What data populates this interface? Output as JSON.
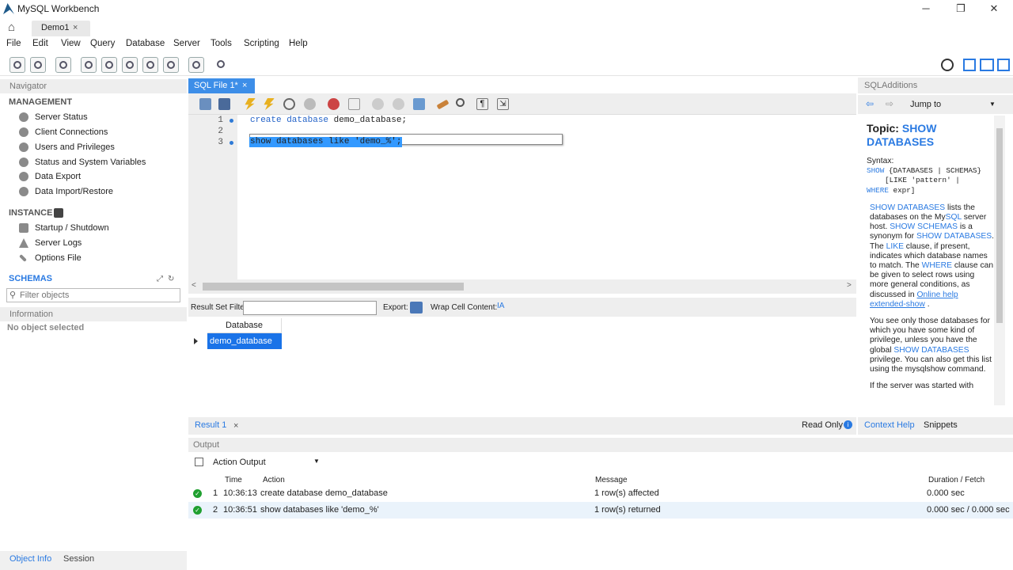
{
  "window": {
    "title": "MySQL Workbench",
    "minimize_icon": "minimize-icon",
    "restore_icon": "restore-icon",
    "close_icon": "close-icon"
  },
  "tabs": {
    "connection_tab": "Demo1",
    "close": "×"
  },
  "menu": [
    "File",
    "Edit",
    "View",
    "Query",
    "Database",
    "Server",
    "Tools",
    "Scripting",
    "Help"
  ],
  "navigator": {
    "header": "Navigator",
    "management_title": "MANAGEMENT",
    "management_items": [
      "Server Status",
      "Client Connections",
      "Users and Privileges",
      "Status and System Variables",
      "Data Export",
      "Data Import/Restore"
    ],
    "instance_title": "INSTANCE",
    "instance_items": [
      "Startup / Shutdown",
      "Server Logs",
      "Options File"
    ],
    "schemas_title": "SCHEMAS",
    "filter_placeholder": "Filter objects",
    "information_header": "Information",
    "no_object": "No object selected",
    "bottom_tabs": [
      "Object Info",
      "Session"
    ]
  },
  "editor": {
    "tab_label": "SQL File 1*",
    "tab_close": "×",
    "lines": [
      "1",
      "2",
      "3"
    ],
    "line1_kw": "create database",
    "line1_rest": " demo_database;",
    "line3": "show databases like 'demo_%';"
  },
  "results": {
    "filter_label": "Result Set Filter:",
    "export_label": "Export:",
    "wrap_label": "Wrap Cell Content:",
    "column": "Database",
    "rows": [
      "demo_database"
    ],
    "result_tab": "Result 1",
    "result_close": "×",
    "read_only": "Read Only"
  },
  "output": {
    "header": "Output",
    "selector": "Action Output",
    "columns": {
      "time": "Time",
      "action": "Action",
      "message": "Message",
      "duration": "Duration / Fetch"
    },
    "rows": [
      {
        "n": "1",
        "time": "10:36:13",
        "action": "create database demo_database",
        "message": "1 row(s) affected",
        "duration": "0.000 sec"
      },
      {
        "n": "2",
        "time": "10:36:51",
        "action": "show databases like 'demo_%'",
        "message": "1 row(s) returned",
        "duration": "0.000 sec / 0.000 sec"
      }
    ]
  },
  "sql_additions": {
    "header": "SQLAdditions",
    "jump_to": "Jump to",
    "topic_label": "Topic:",
    "topic_name": "SHOW DATABASES",
    "syntax_label": "Syntax:",
    "syntax_l1a": "SHOW",
    "syntax_l1b": " {DATABASES | SCHEMAS}",
    "syntax_l2": "[LIKE 'pattern' |",
    "syntax_l3a": "WHERE",
    "syntax_l3b": " expr]",
    "p1_a": "SHOW DATABASES",
    "p1_b": " lists the databases on the My",
    "p1_c": "SQL",
    "p1_d": " server host. ",
    "p1_e": "SHOW SCHEMAS",
    "p1_f": " is a synonym for ",
    "p1_g": "SHOW DATABASES",
    "p1_h": ". The ",
    "p1_i": "LIKE",
    "p1_j": " clause, if present, indicates which database names to match. The ",
    "p1_k": "WHERE",
    "p1_l": " clause can be given to select rows using more general conditions, as discussed in ",
    "p1_m": "Online help extended-show",
    "p1_n": " .",
    "p2_a": "You see only those databases for which you have some kind of privilege, unless you have the global ",
    "p2_b": "SHOW DATABASES",
    "p2_c": " privilege. You can also get this list using the mysqlshow command.",
    "p3": "If the server was started with",
    "bottom_tabs": [
      "Context Help",
      "Snippets"
    ]
  },
  "colors": {
    "accent": "#3d8ee8",
    "selection": "#1a73e8",
    "link": "#2a7ae2",
    "ok": "#20a030"
  }
}
